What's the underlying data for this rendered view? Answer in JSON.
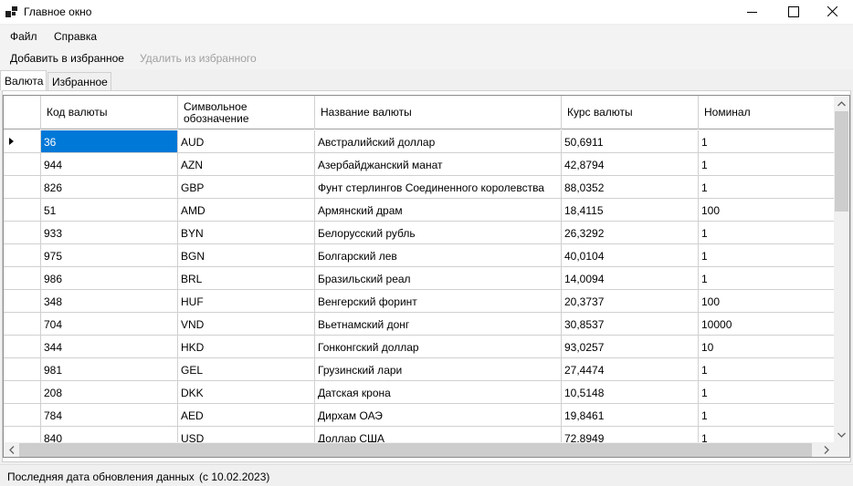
{
  "window": {
    "title": "Главное окно"
  },
  "menu": {
    "file": "Файл",
    "help": "Справка"
  },
  "toolbar": {
    "add_favorite": "Добавить в избранное",
    "remove_favorite": "Удалить из избранного"
  },
  "tabs": {
    "currency": "Валюта",
    "favorites": "Избранное"
  },
  "grid": {
    "columns": [
      "Код валюты",
      "Символьное обозначение",
      "Название валюты",
      "Курс валюты",
      "Номинал"
    ],
    "rows": [
      [
        "36",
        "AUD",
        "Австралийский доллар",
        "50,6911",
        "1"
      ],
      [
        "944",
        "AZN",
        "Азербайджанский манат",
        "42,8794",
        "1"
      ],
      [
        "826",
        "GBP",
        "Фунт стерлингов Соединенного королевства",
        "88,0352",
        "1"
      ],
      [
        "51",
        "AMD",
        "Армянский драм",
        "18,4115",
        "100"
      ],
      [
        "933",
        "BYN",
        "Белорусский рубль",
        "26,3292",
        "1"
      ],
      [
        "975",
        "BGN",
        "Болгарский лев",
        "40,0104",
        "1"
      ],
      [
        "986",
        "BRL",
        "Бразильский реал",
        "14,0094",
        "1"
      ],
      [
        "348",
        "HUF",
        "Венгерский форинт",
        "20,3737",
        "100"
      ],
      [
        "704",
        "VND",
        "Вьетнамский донг",
        "30,8537",
        "10000"
      ],
      [
        "344",
        "HKD",
        "Гонконгский доллар",
        "93,0257",
        "10"
      ],
      [
        "981",
        "GEL",
        "Грузинский лари",
        "27,4474",
        "1"
      ],
      [
        "208",
        "DKK",
        "Датская крона",
        "10,5148",
        "1"
      ],
      [
        "784",
        "AED",
        "Дирхам ОАЭ",
        "19,8461",
        "1"
      ],
      [
        "840",
        "USD",
        "Доллар США",
        "72,8949",
        "1"
      ]
    ]
  },
  "status": {
    "label": "Последняя дата обновления данных",
    "date": "(с 10.02.2023)"
  }
}
